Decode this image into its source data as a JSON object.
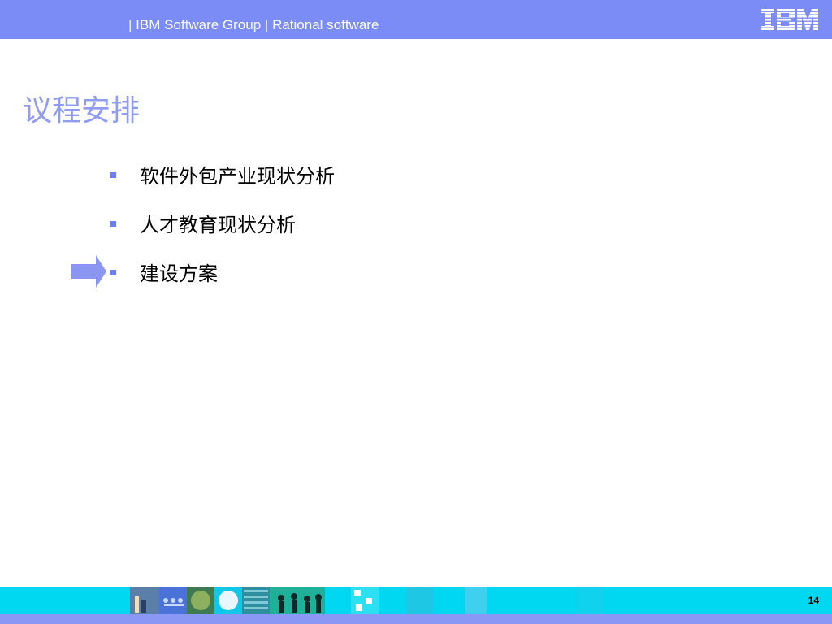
{
  "header": {
    "group": "IBM Software Group",
    "separator": "|",
    "division": "Rational software",
    "logo_icon": "ibm-logo"
  },
  "slide": {
    "title": "议程安排",
    "agenda": [
      {
        "text": "软件外包产业现状分析",
        "current": false
      },
      {
        "text": "人才教育现状分析",
        "current": false
      },
      {
        "text": "建设方案",
        "current": true
      }
    ],
    "current_marker_icon": "arrow-right-icon"
  },
  "footer": {
    "page_number": "14"
  },
  "colors": {
    "header_bar": "#7b8cf6",
    "title": "#8f9cf2",
    "bullet": "#6f7ff0",
    "footer_bar": "#00d7f0",
    "footer_stripe": "#8a97f4"
  }
}
